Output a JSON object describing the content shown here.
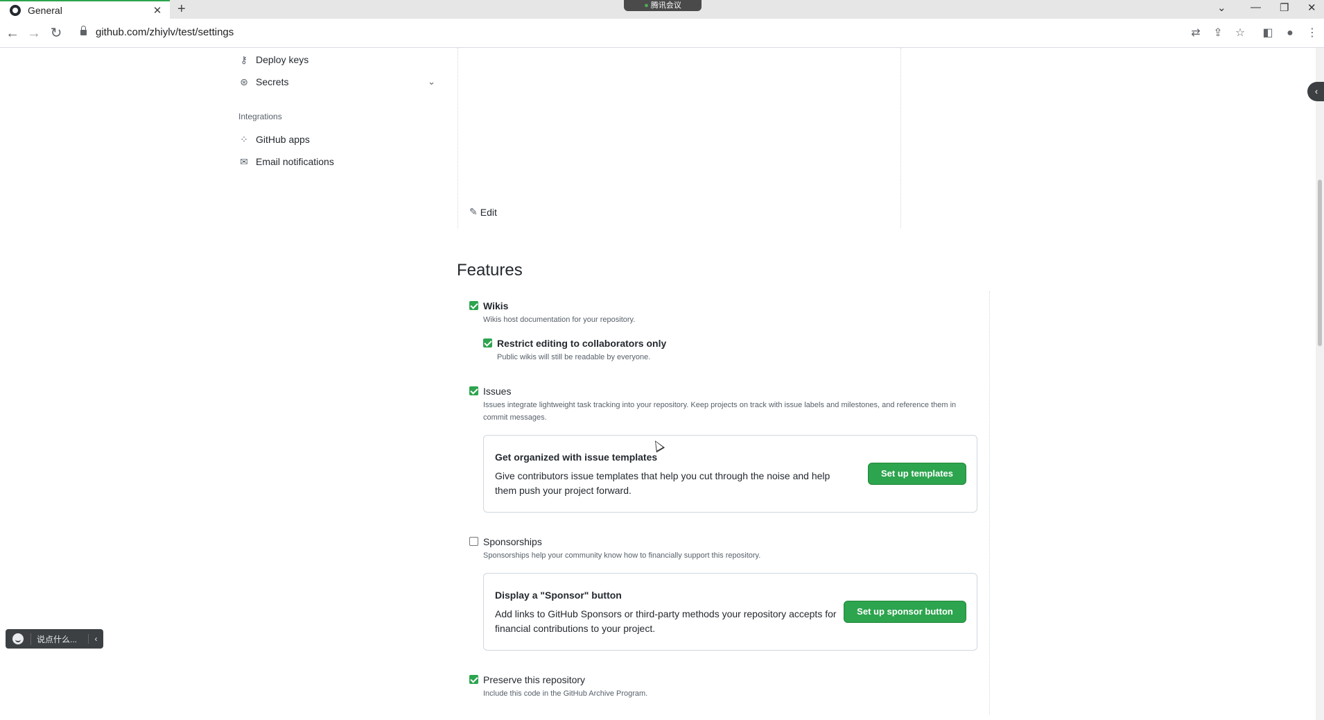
{
  "browser": {
    "tab_title": "General",
    "tab_close": "✕",
    "new_tab": "+",
    "meeting_label": "腾讯会议",
    "url": "github.com/zhiylv/test/settings",
    "icons": [
      "back-icon",
      "forward-icon",
      "reload-icon",
      "lock-icon",
      "translate-icon",
      "share-icon",
      "star-icon",
      "side-panel-icon",
      "profile-icon",
      "menu-icon"
    ]
  },
  "sidebar": {
    "items_top": [
      {
        "label": "Deploy keys",
        "icon": "key-icon"
      },
      {
        "label": "Secrets",
        "icon": "asterisk-icon",
        "expandable": true
      }
    ],
    "integrations_heading": "Integrations",
    "items_integrations": [
      {
        "label": "GitHub apps",
        "icon": "apps-icon"
      },
      {
        "label": "Email notifications",
        "icon": "mail-icon"
      }
    ]
  },
  "main": {
    "edit_label": "Edit",
    "features_title": "Features",
    "features": {
      "wikis": {
        "label": "Wikis",
        "desc": "Wikis host documentation for your repository.",
        "checked": true
      },
      "restrict_wiki": {
        "label": "Restrict editing to collaborators only",
        "desc": "Public wikis will still be readable by everyone.",
        "checked": true
      },
      "issues": {
        "label": "Issues",
        "desc": "Issues integrate lightweight task tracking into your repository. Keep projects on track with issue labels and milestones, and reference them in commit messages.",
        "checked": true
      },
      "sponsorships": {
        "label": "Sponsorships",
        "desc": "Sponsorships help your community know how to financially support this repository.",
        "checked": false
      },
      "preserve": {
        "label": "Preserve this repository",
        "desc": "Include this code in the GitHub Archive Program.",
        "checked": true
      }
    },
    "issue_templates_box": {
      "title": "Get organized with issue templates",
      "text": "Give contributors issue templates that help you cut through the noise and help them push your project forward.",
      "button": "Set up templates"
    },
    "sponsor_box": {
      "title": "Display a \"Sponsor\" button",
      "text": "Add links to GitHub Sponsors or third-party methods your repository accepts for financial contributions to your project.",
      "button": "Set up sponsor button"
    }
  },
  "chat_widget": {
    "placeholder": "说点什么...",
    "collapse": "‹"
  },
  "colors": {
    "accent_green": "#2da44e",
    "text": "#24292f",
    "muted": "#57606a",
    "border": "#d0d7de"
  }
}
